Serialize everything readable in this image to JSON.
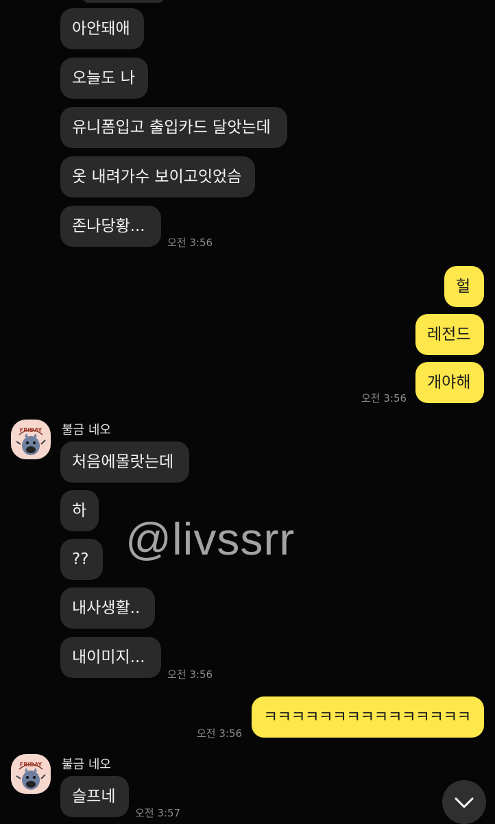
{
  "incoming_group_1": {
    "messages": [
      "아안돼애",
      "오늘도 나",
      "유니폼입고 출입카드 달앗는데",
      "옷 내려가수 보이고잇었슴",
      "존나당황..."
    ],
    "time": "오전 3:56"
  },
  "outgoing_group_1": {
    "messages": [
      "헐",
      "레전드",
      "개야해"
    ],
    "time": "오전 3:56"
  },
  "incoming_group_2": {
    "sender": "불금 네오",
    "avatar_text": "FRIDAY",
    "messages": [
      "처음에몰랏는데",
      "하",
      "??",
      "내사생활..",
      "내이미지..."
    ],
    "time": "오전 3:56"
  },
  "outgoing_group_2": {
    "messages": [
      "ㅋㅋㅋㅋㅋㅋㅋㅋㅋㅋㅋㅋㅋㅋㅋ"
    ],
    "time": "오전 3:56"
  },
  "incoming_group_3": {
    "sender": "불금 네오",
    "avatar_text": "FRIDAY",
    "messages": [
      "슬프네"
    ],
    "time": "오전 3:57"
  },
  "watermark": "@livssrr",
  "scroll_button_icon": "chevron-down-icon",
  "colors": {
    "background": "#060606",
    "incoming_bubble": "#2a2a2a",
    "outgoing_bubble": "#fde74a",
    "timestamp": "#8c8c8c"
  }
}
